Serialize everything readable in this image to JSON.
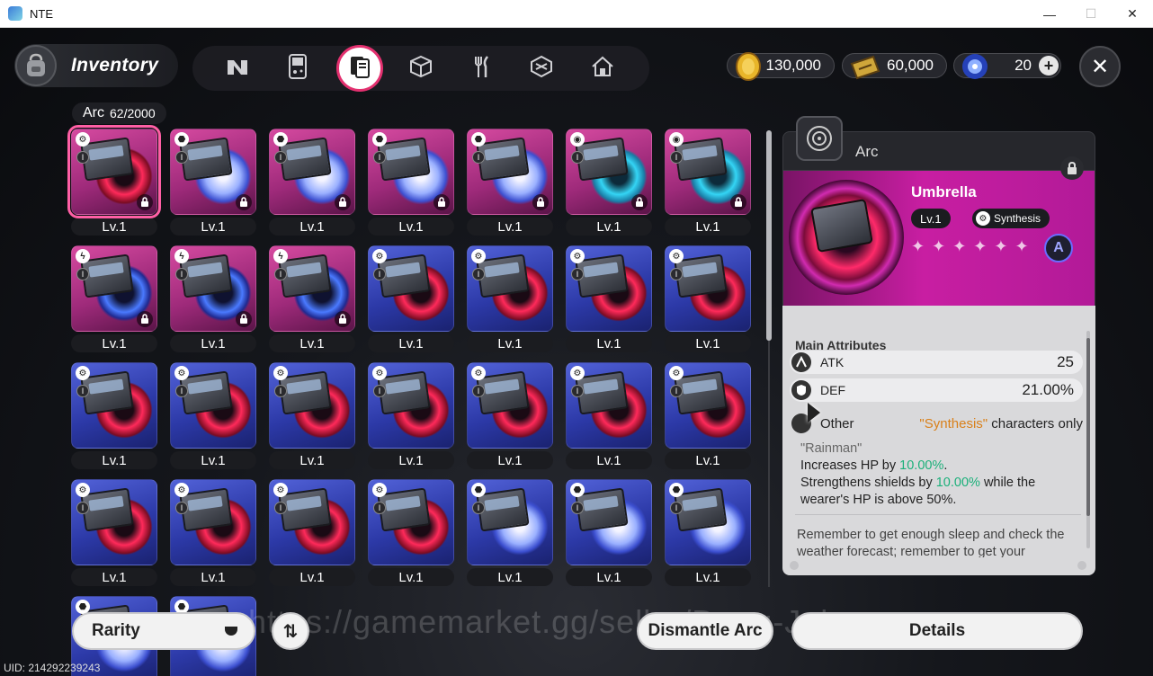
{
  "window": {
    "title": "NTE",
    "minimize": "—",
    "maximize": "☐",
    "close": "✕"
  },
  "header": {
    "title": "Inventory",
    "currencies": [
      {
        "icon": "gold-coin-icon",
        "value": "130,000"
      },
      {
        "icon": "ticket-icon",
        "value": "60,000"
      },
      {
        "icon": "crystal-icon",
        "value": "20"
      }
    ]
  },
  "category": {
    "label": "Arc",
    "count": "62/2000"
  },
  "items": [
    {
      "lv": "Lv.1",
      "color": "pink",
      "disc": "red",
      "type": "gear",
      "locked": true,
      "selected": true
    },
    {
      "lv": "Lv.1",
      "color": "pink",
      "disc": "white",
      "type": "shield",
      "locked": true
    },
    {
      "lv": "Lv.1",
      "color": "pink",
      "disc": "white",
      "type": "shield",
      "locked": true
    },
    {
      "lv": "Lv.1",
      "color": "pink",
      "disc": "white",
      "type": "shield",
      "locked": true
    },
    {
      "lv": "Lv.1",
      "color": "pink",
      "disc": "white",
      "type": "shield",
      "locked": true
    },
    {
      "lv": "Lv.1",
      "color": "pink",
      "disc": "cyan",
      "type": "swirl",
      "locked": true
    },
    {
      "lv": "Lv.1",
      "color": "pink",
      "disc": "cyan",
      "type": "swirl",
      "locked": true
    },
    {
      "lv": "Lv.1",
      "color": "pink",
      "disc": "storm",
      "type": "bolt",
      "locked": true
    },
    {
      "lv": "Lv.1",
      "color": "pink",
      "disc": "storm",
      "type": "bolt",
      "locked": true
    },
    {
      "lv": "Lv.1",
      "color": "pink",
      "disc": "storm",
      "type": "bolt",
      "locked": true
    },
    {
      "lv": "Lv.1",
      "color": "blue",
      "disc": "red",
      "type": "gear",
      "locked": false
    },
    {
      "lv": "Lv.1",
      "color": "blue",
      "disc": "red",
      "type": "gear",
      "locked": false
    },
    {
      "lv": "Lv.1",
      "color": "blue",
      "disc": "red",
      "type": "gear",
      "locked": false
    },
    {
      "lv": "Lv.1",
      "color": "blue",
      "disc": "red",
      "type": "gear",
      "locked": false
    },
    {
      "lv": "Lv.1",
      "color": "blue",
      "disc": "red",
      "type": "gear",
      "locked": false
    },
    {
      "lv": "Lv.1",
      "color": "blue",
      "disc": "red",
      "type": "gear",
      "locked": false
    },
    {
      "lv": "Lv.1",
      "color": "blue",
      "disc": "red",
      "type": "gear",
      "locked": false
    },
    {
      "lv": "Lv.1",
      "color": "blue",
      "disc": "red",
      "type": "gear",
      "locked": false
    },
    {
      "lv": "Lv.1",
      "color": "blue",
      "disc": "red",
      "type": "gear",
      "locked": false
    },
    {
      "lv": "Lv.1",
      "color": "blue",
      "disc": "red",
      "type": "gear",
      "locked": false
    },
    {
      "lv": "Lv.1",
      "color": "blue",
      "disc": "red",
      "type": "gear",
      "locked": false
    },
    {
      "lv": "Lv.1",
      "color": "blue",
      "disc": "red",
      "type": "gear",
      "locked": false
    },
    {
      "lv": "Lv.1",
      "color": "blue",
      "disc": "red",
      "type": "gear",
      "locked": false
    },
    {
      "lv": "Lv.1",
      "color": "blue",
      "disc": "red",
      "type": "gear",
      "locked": false
    },
    {
      "lv": "Lv.1",
      "color": "blue",
      "disc": "red",
      "type": "gear",
      "locked": false
    },
    {
      "lv": "Lv.1",
      "color": "blue",
      "disc": "white",
      "type": "shield",
      "locked": false
    },
    {
      "lv": "Lv.1",
      "color": "blue",
      "disc": "white",
      "type": "shield",
      "locked": false
    },
    {
      "lv": "Lv.1",
      "color": "blue",
      "disc": "white",
      "type": "shield",
      "locked": false
    },
    {
      "lv": "Lv.1",
      "color": "blue",
      "disc": "white",
      "type": "shield",
      "locked": false
    },
    {
      "lv": "Lv.1",
      "color": "blue",
      "disc": "white",
      "type": "shield",
      "locked": false
    }
  ],
  "detail": {
    "header_label": "Arc",
    "name": "Umbrella",
    "level": "Lv.1",
    "tag": "Synthesis",
    "stars": [
      "✦",
      "✦",
      "✦",
      "✦",
      "✦",
      "✦"
    ],
    "rarity_letter": "A",
    "main_attributes_title": "Main Attributes",
    "attributes": [
      {
        "name": "ATK",
        "value": "25",
        "icon": "atk-icon"
      },
      {
        "name": "DEF",
        "value": "21.00%",
        "icon": "def-icon"
      }
    ],
    "effect": {
      "name": "Other",
      "req_prefix": "\"Synthesis\"",
      "req_suffix": " characters only",
      "quote": "\"Rainman\"",
      "line1_a": "Increases HP by ",
      "line1_b": "10.00%",
      "line1_c": ".",
      "line2_a": "Strengthens shields by ",
      "line2_b": "10.00%",
      "line2_c": " while the wearer's HP is above 50%."
    },
    "flavor": "Remember to get enough sleep and check the weather forecast; remember to get your"
  },
  "bottom": {
    "rarity_select": "Rarity",
    "sort_icon": "⇅",
    "dismantle": "Dismantle Arc",
    "details": "Details"
  },
  "uid": "UID: 214292239243",
  "watermark": "https://gamemarket.gg/seller/Dang-John",
  "colors": {
    "pink_card": "#c23c96",
    "blue_card": "#3a48c0",
    "accent": "#e3306f",
    "highlight_green": "#1bb07a",
    "highlight_orange": "#d9801a"
  }
}
